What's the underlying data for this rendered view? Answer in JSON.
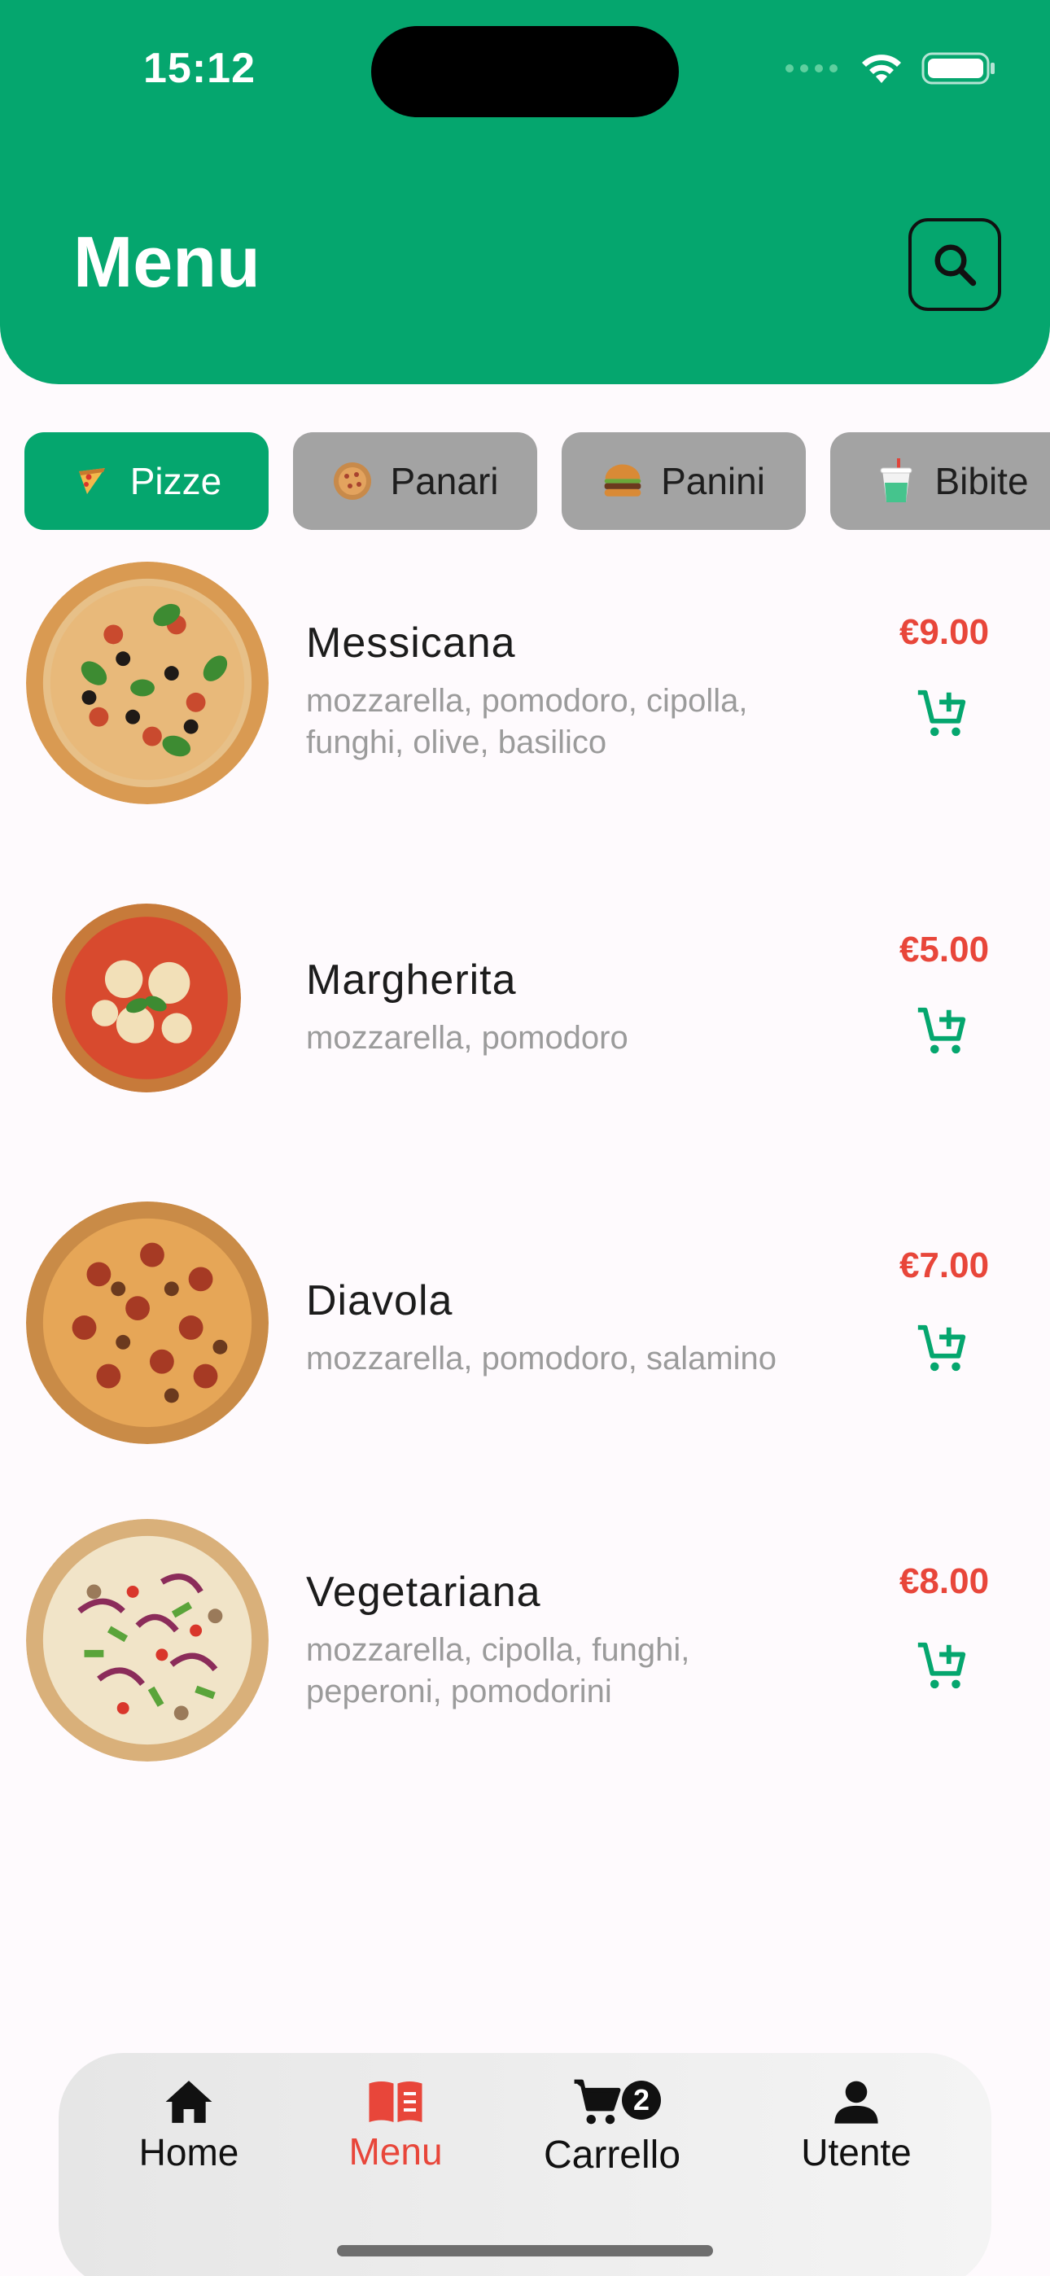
{
  "status": {
    "time": "15:12"
  },
  "header": {
    "title": "Menu"
  },
  "categories": [
    {
      "label": "Pizze",
      "icon": "pizza-slice-icon",
      "active": true
    },
    {
      "label": "Panari",
      "icon": "panaro-icon",
      "active": false
    },
    {
      "label": "Panini",
      "icon": "burger-icon",
      "active": false
    },
    {
      "label": "Bibite",
      "icon": "drink-cup-icon",
      "active": false
    }
  ],
  "items": [
    {
      "name": "Messicana",
      "desc": "mozzarella, pomodoro, cipolla, funghi, olive, basilico",
      "price": "€9.00"
    },
    {
      "name": "Margherita",
      "desc": "mozzarella, pomodoro",
      "price": "€5.00"
    },
    {
      "name": "Diavola",
      "desc": "mozzarella, pomodoro, salamino",
      "price": "€7.00"
    },
    {
      "name": "Vegetariana",
      "desc": "mozzarella, cipolla, funghi, peperoni, pomodorini",
      "price": "€8.00"
    }
  ],
  "nav": {
    "home": "Home",
    "menu": "Menu",
    "cart": "Carrello",
    "cart_badge": "2",
    "user": "Utente"
  },
  "colors": {
    "brand": "#05a66e",
    "price": "#e8463a",
    "chip_inactive": "#a3a3a3"
  }
}
